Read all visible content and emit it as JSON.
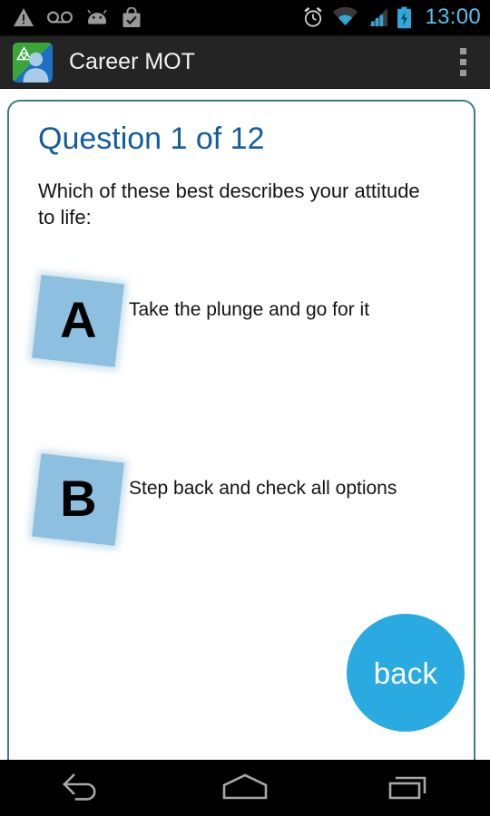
{
  "status_bar": {
    "clock": "13:00",
    "clock_color": "#59c0e8",
    "left_icons": [
      {
        "name": "warning-triangle-icon",
        "label": "warning"
      },
      {
        "name": "voicemail-icon",
        "label": "voicemail"
      },
      {
        "name": "android-robot-icon",
        "label": "android"
      },
      {
        "name": "play-store-bag-icon",
        "label": "store"
      }
    ],
    "right_icons": [
      {
        "name": "alarm-clock-icon",
        "label": "alarm"
      },
      {
        "name": "wifi-icon",
        "label": "wifi"
      },
      {
        "name": "cellular-signal-icon",
        "label": "signal"
      },
      {
        "name": "battery-charging-icon",
        "label": "battery charging"
      }
    ]
  },
  "action_bar": {
    "app_title": "Career MOT",
    "app_icon": "career-mot-app-icon",
    "overflow_label": "More options",
    "background": "#242424"
  },
  "card": {
    "border_color": "#3c7e7e",
    "question_number": "Question 1 of 12",
    "question_color": "#135d9f",
    "question_text": "Which of these best describes your attitude to life:",
    "options": [
      {
        "letter": "A",
        "text": "Take the plunge and go for it",
        "tile_color": "#8dbfe0"
      },
      {
        "letter": "B",
        "text": "Step back and check all options",
        "tile_color": "#8dbfe0"
      }
    ],
    "back_button": {
      "label": "back",
      "color": "#29abe2",
      "text_color": "#ffffff"
    }
  },
  "nav_bar": {
    "buttons": [
      {
        "name": "nav-back-button",
        "label": "Back"
      },
      {
        "name": "nav-home-button",
        "label": "Home"
      },
      {
        "name": "nav-recents-button",
        "label": "Recent apps"
      }
    ]
  }
}
